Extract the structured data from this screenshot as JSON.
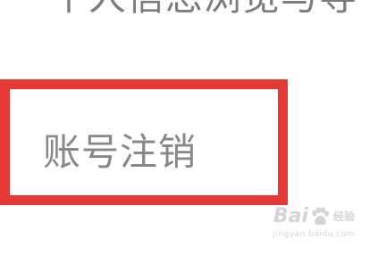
{
  "settings_list": {
    "previous_item_label": "个人信息浏览与导",
    "highlighted_item_label": "账号注销"
  },
  "highlight": {
    "color": "#e53935"
  },
  "watermark": {
    "brand_left": "Bai",
    "brand_right": "经验",
    "url": "jingyan.baidu.com",
    "icon": "baidu-paw-icon"
  }
}
